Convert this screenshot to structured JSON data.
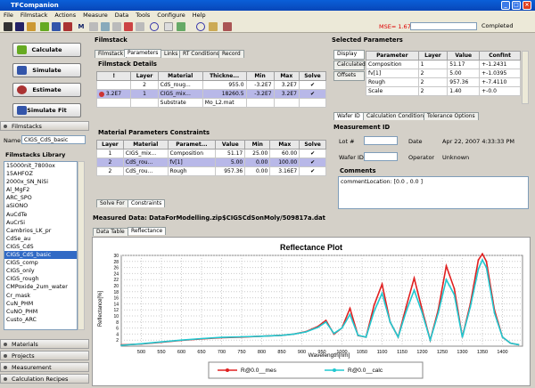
{
  "app": {
    "title": "TFCompanion",
    "mse": "MSE= 1.677",
    "completed_label": "Completed",
    "window_buttons": [
      "_",
      "□",
      "×"
    ]
  },
  "menu": [
    "File",
    "Filmstack",
    "Actions",
    "Measure",
    "Data",
    "Tools",
    "Configure",
    "Help"
  ],
  "left": {
    "buttons": [
      "Calculate",
      "Simulate",
      "Estimate",
      "Simulate Fit"
    ],
    "section_filmstacks": "Filmstacks",
    "name_label": "Name",
    "name_value": "CIGS_CdS_basic",
    "library_label": "Filmstacks Library",
    "library_items": [
      "15000nit_7800ox",
      "15AHFOZ",
      "2000x_SN_NiSi",
      "Al_MgF2",
      "ARC_SPO",
      "aSiONO",
      "AuCdTe",
      "AuCrSi",
      "Cambrios_LK_pr",
      "CdSe_au",
      "CIGS_CdS",
      "CIGS_CdS_basic",
      "CIGS_comp",
      "CIGS_only",
      "CIGS_rough",
      "CMPoxide_2um_water",
      "Cr_mask",
      "CuN_PHM",
      "CuNO_PHM",
      "Custo_ARC"
    ],
    "selected_item": "CIGS_CdS_basic",
    "bottom_sections": [
      "Materials",
      "Projects",
      "Measurement",
      "Calculation Recipes"
    ]
  },
  "filmstack": {
    "title": "Filmstack",
    "tabs": [
      "Filmstack",
      "Parameters",
      "Links",
      "RT Conditions",
      "Record"
    ],
    "details_title": "Filmstack Details",
    "columns": [
      "!",
      "Layer",
      "Material",
      "Thickne...",
      "Min",
      "Max",
      "Solve"
    ],
    "rows": [
      [
        "",
        "2",
        "CdS_roug...",
        "955.0",
        "-3.2E7",
        "3.2E7",
        "✔"
      ],
      [
        "3.2E7",
        "1",
        "CIGS_mix...",
        "18260.5",
        "-3.2E7",
        "3.2E7",
        "✔"
      ],
      [
        "",
        "",
        "Substrate",
        "Mo_L2.mat",
        "",
        "",
        ""
      ]
    ],
    "constraints_title": "Material Parameters Constraints",
    "c_columns": [
      "Layer",
      "Material",
      "Paramet...",
      "Value",
      "Min",
      "Max",
      "Solve"
    ],
    "c_rows": [
      [
        "1",
        "CIGS_mix...",
        "Composition",
        "51.17",
        "25.00",
        "60.00",
        "✔"
      ],
      [
        "2",
        "CdS_rou...",
        "fv[1]",
        "5.00",
        "0.00",
        "100.00",
        "✔"
      ],
      [
        "2",
        "CdS_rou...",
        "Rough",
        "957.36",
        "0.00",
        "3.16E7",
        "✔"
      ]
    ],
    "bottom_tabs": [
      "Solve For",
      "Constraints"
    ]
  },
  "selected_params": {
    "title": "Selected Parameters",
    "side_tabs": [
      "Display",
      "Calculated",
      "Offsets"
    ],
    "columns": [
      "Parameter",
      "Layer",
      "Value",
      "ConfInt"
    ],
    "rows": [
      [
        "Composition",
        "1",
        "51.17",
        "+-1.2431"
      ],
      [
        "fv[1]",
        "2",
        "5.00",
        "+-1.0395"
      ],
      [
        "Rough",
        "2",
        "957.36",
        "+-7.4110"
      ],
      [
        "Scale",
        "2",
        "1.40",
        "+-0.0"
      ]
    ]
  },
  "wafer": {
    "tabs": [
      "Wafer ID",
      "Calculation Conditions",
      "Tolerance Options"
    ],
    "title": "Measurement ID",
    "lot_label": "Lot #",
    "date_label": "Date",
    "date_value": "Apr 22, 2007 4:33:33 PM",
    "wafer_label": "Wafer ID",
    "operator_label": "Operator",
    "operator_value": "Unknown",
    "comments_label": "Comments",
    "comments_value": "commentLocation: [0.0 , 0.0 ]"
  },
  "measured": {
    "title": "Measured Data: DataForModelling.zip$CIGSCdSonMoly/509817a.dat",
    "tabs": [
      "Data Table",
      "Reflectance"
    ]
  },
  "chart_data": {
    "type": "line",
    "title": "Reflectance Plot",
    "xlabel": "Wavelength[nm]",
    "ylabel": "Reflectance[%]",
    "xlim": [
      450,
      1450
    ],
    "ylim": [
      0,
      30
    ],
    "xticks": [
      500,
      550,
      600,
      650,
      700,
      750,
      800,
      850,
      900,
      950,
      1000,
      1050,
      1100,
      1150,
      1200,
      1250,
      1300,
      1350,
      1400
    ],
    "yticks": [
      2,
      4,
      6,
      8,
      10,
      12,
      14,
      16,
      18,
      20,
      22,
      24,
      26,
      28,
      30
    ],
    "legend_position": "bottom",
    "series": [
      {
        "name": "R@0.0__mes",
        "color": "#e02020",
        "x": [
          450,
          500,
          550,
          600,
          650,
          700,
          750,
          800,
          850,
          880,
          910,
          940,
          960,
          980,
          1000,
          1020,
          1040,
          1060,
          1080,
          1100,
          1120,
          1140,
          1160,
          1180,
          1200,
          1220,
          1240,
          1260,
          1280,
          1300,
          1320,
          1340,
          1350,
          1360,
          1380,
          1400,
          1420,
          1440
        ],
        "y": [
          0.4,
          0.7,
          1.3,
          1.9,
          2.4,
          2.8,
          3.0,
          3.3,
          3.6,
          4.0,
          4.8,
          6.5,
          8.5,
          4.0,
          6.0,
          12.5,
          3.5,
          3.0,
          13.5,
          20.5,
          8.0,
          3.0,
          13.0,
          22.5,
          12.0,
          2.0,
          12.0,
          26.5,
          19.0,
          3.0,
          14.0,
          28.5,
          30.5,
          28.0,
          12.0,
          3.0,
          1.0,
          0.5
        ]
      },
      {
        "name": "R@0.0__calc",
        "color": "#20c8d0",
        "x": [
          450,
          500,
          550,
          600,
          650,
          700,
          750,
          800,
          850,
          880,
          910,
          940,
          960,
          980,
          1000,
          1020,
          1040,
          1060,
          1080,
          1100,
          1120,
          1140,
          1160,
          1180,
          1200,
          1220,
          1240,
          1260,
          1280,
          1300,
          1320,
          1340,
          1350,
          1360,
          1380,
          1400,
          1420,
          1440
        ],
        "y": [
          0.3,
          0.8,
          1.4,
          2.0,
          2.5,
          2.9,
          3.1,
          3.3,
          3.6,
          4.0,
          4.7,
          6.2,
          8.0,
          4.2,
          6.0,
          10.5,
          3.6,
          3.0,
          11.5,
          17.5,
          8.0,
          3.0,
          11.5,
          18.5,
          11.0,
          2.0,
          11.0,
          22.0,
          17.0,
          3.0,
          13.0,
          25.5,
          28.5,
          26.0,
          11.0,
          3.0,
          1.0,
          0.5
        ]
      }
    ]
  }
}
